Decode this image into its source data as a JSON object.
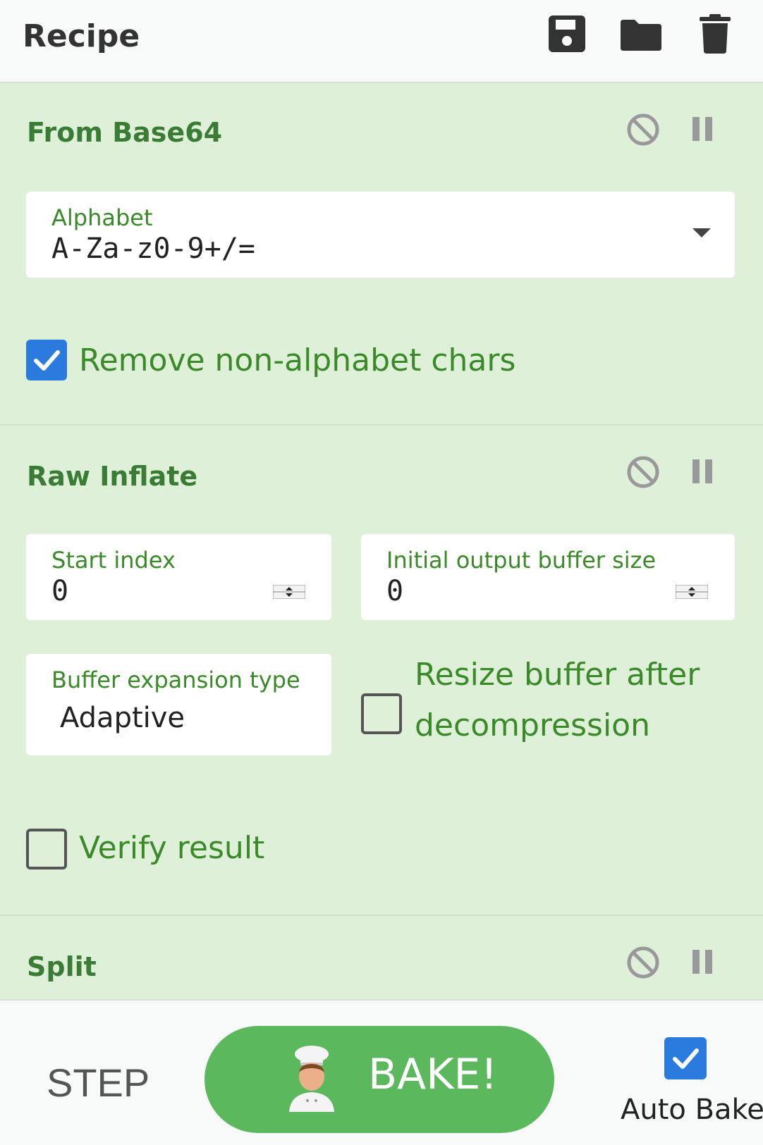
{
  "header": {
    "title": "Recipe",
    "icons": [
      "save-icon",
      "folder-icon",
      "trash-icon"
    ]
  },
  "operations": [
    {
      "title": "From Base64",
      "fields": [
        {
          "label": "Alphabet",
          "value": "A-Za-z0-9+/="
        }
      ],
      "checkboxes": [
        {
          "label": "Remove non-alphabet chars",
          "checked": true
        }
      ]
    },
    {
      "title": "Raw Inflate",
      "fields": [
        {
          "label": "Start index",
          "value": "0"
        },
        {
          "label": "Initial output buffer size",
          "value": "0"
        },
        {
          "label": "Buffer expansion type",
          "value": "Adaptive"
        }
      ],
      "checkboxes": [
        {
          "label_line1": "Resize buffer after",
          "label_line2": "decompression",
          "checked": false
        },
        {
          "label": "Verify result",
          "checked": false
        }
      ]
    },
    {
      "title": "Split"
    }
  ],
  "footer": {
    "step_label": "STEP",
    "bake_label": "BAKE!",
    "auto_bake_label": "Auto Bake",
    "auto_bake_checked": true
  },
  "colors": {
    "recipe_bg": "#dff0d8",
    "op_title": "#3a7b36",
    "label_green": "#3a8a2a",
    "checkbox_blue": "#2b7bdf",
    "bake_green": "#5cb85c"
  }
}
